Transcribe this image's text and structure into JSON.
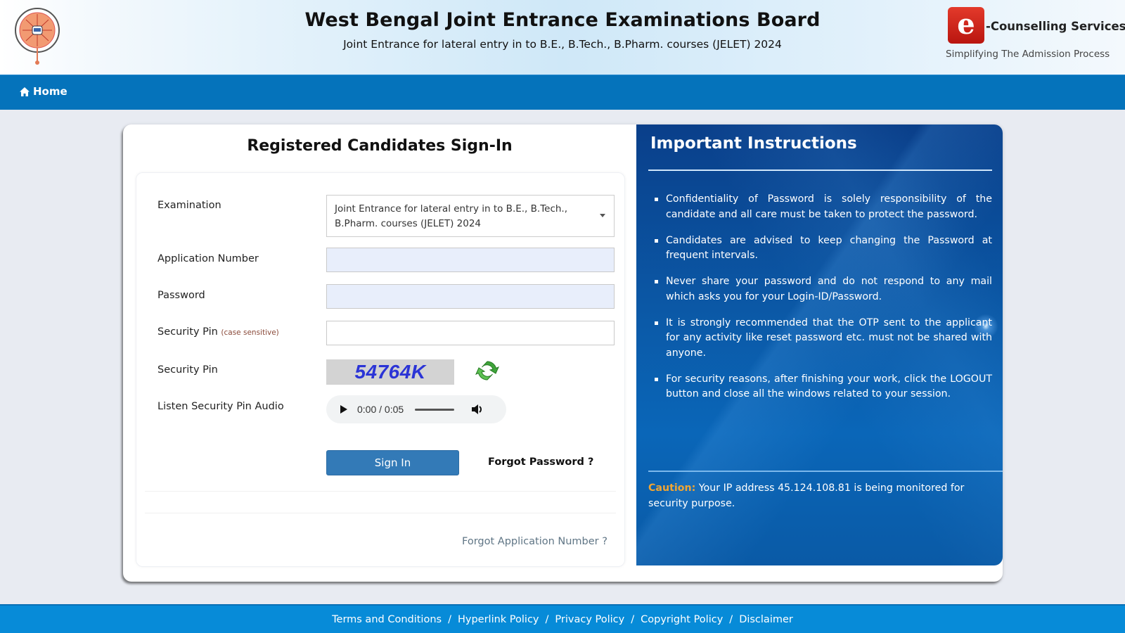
{
  "header": {
    "title": "West Bengal Joint Entrance Examinations Board",
    "subtitle": "Joint Entrance for lateral entry in to B.E., B.Tech., B.Pharm. courses (JELET) 2024",
    "brand_letter": "e",
    "brand_name": "-Counselling Services",
    "brand_tagline": "Simplifying The Admission Process"
  },
  "nav": {
    "home_label": "Home",
    "home_icon": "home-icon"
  },
  "signin": {
    "title": "Registered Candidates Sign-In",
    "fields": {
      "examination": {
        "label": "Examination",
        "value": "Joint Entrance for lateral entry in to B.E., B.Tech., B.Pharm. courses (JELET) 2024"
      },
      "application_number": {
        "label": "Application Number",
        "value": "",
        "placeholder": ""
      },
      "password": {
        "label": "Password",
        "value": "",
        "placeholder": ""
      },
      "security_pin_input": {
        "label": "Security Pin",
        "hint": "(case sensitive)",
        "value": "",
        "placeholder": ""
      },
      "security_pin_image": {
        "label": "Security Pin",
        "captcha_text": "54764K",
        "refresh_icon": "refresh-icon"
      },
      "audio": {
        "label": "Listen Security Pin Audio",
        "time": "0:00 / 0:05",
        "play_icon": "play-icon",
        "volume_icon": "volume-icon"
      }
    },
    "signin_button": "Sign In",
    "forgot_password": "Forgot Password ?",
    "forgot_application_number": "Forgot Application Number ?"
  },
  "instructions": {
    "title": "Important Instructions",
    "items": [
      "Confidentiality of Password is solely responsibility of the candidate and all care must be taken to protect the password.",
      "Candidates are advised to keep changing the Password at frequent intervals.",
      "Never share your password and do not respond to any mail which asks you for your Login-ID/Password.",
      "It is strongly recommended that the OTP sent to the applicant for any activity like reset password etc. must not be shared with anyone.",
      "For security reasons, after finishing your work, click the LOGOUT button and close all the windows related to your session."
    ],
    "caution_label": "Caution:",
    "caution_text": " Your IP address 45.124.108.81 is being monitored for security purpose."
  },
  "footer": {
    "links": [
      "Terms and Conditions",
      "Hyperlink Policy",
      "Privacy Policy",
      "Copyright Policy",
      "Disclaimer"
    ],
    "separator": "/"
  },
  "colors": {
    "navbar": "#0573bb",
    "footer": "#078bd8",
    "primary_button": "#337ab7",
    "instructions_panel": "#0b5aa8",
    "caution": "#f0a533",
    "captcha_text": "#2b34d6"
  }
}
